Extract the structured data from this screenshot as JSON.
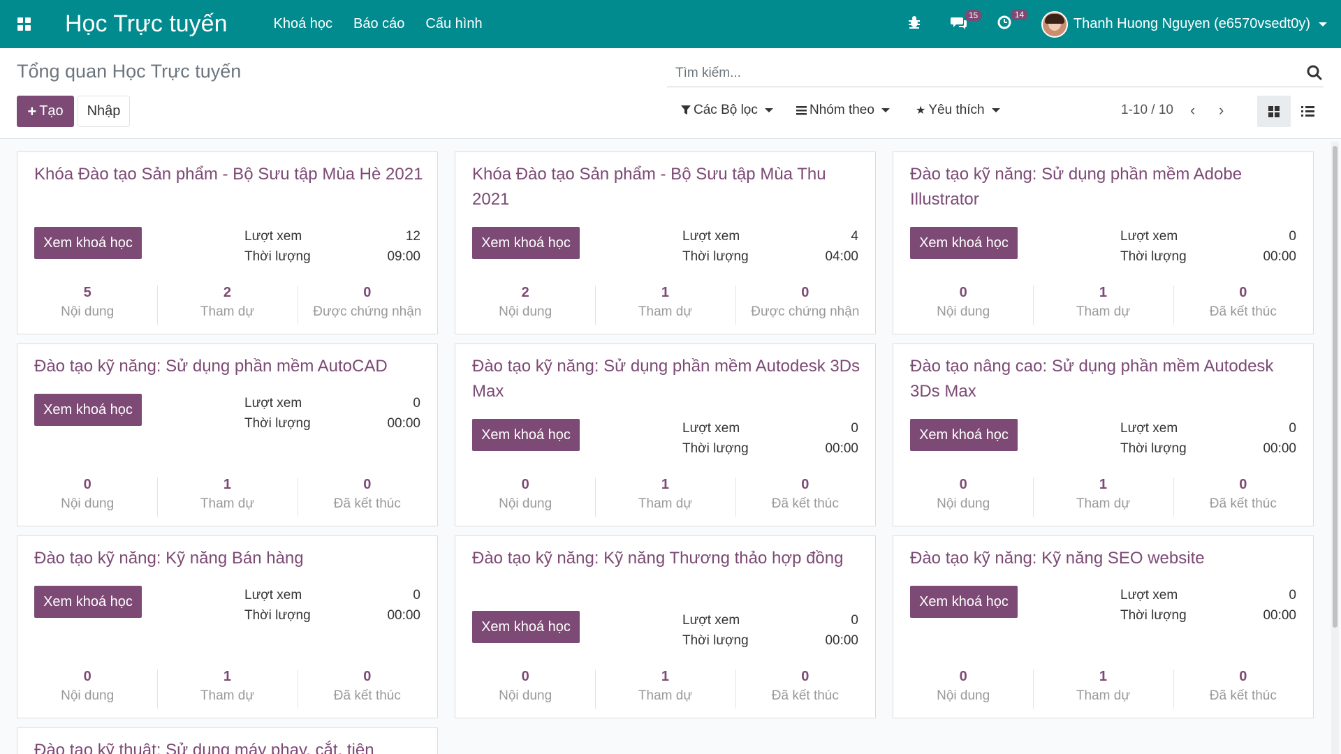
{
  "navbar": {
    "brand": "Học Trực tuyến",
    "menu": [
      "Khoá học",
      "Báo cáo",
      "Cấu hình"
    ],
    "messages_count": "15",
    "activities_count": "14",
    "user_name": "Thanh Huong Nguyen (e6570vsedt0y)"
  },
  "control": {
    "title": "Tổng quan Học Trực tuyến",
    "create_label": "Tạo",
    "import_label": "Nhập",
    "search_placeholder": "Tìm kiếm...",
    "filters_label": "Các Bộ lọc",
    "groupby_label": "Nhóm theo",
    "favorites_label": "Yêu thích",
    "pager": "1-10 / 10"
  },
  "card_labels": {
    "view_button": "Xem khoá học",
    "views": "Lượt xem",
    "duration": "Thời lượng",
    "content": "Nội dung",
    "attendees": "Tham dự",
    "certified": "Được chứng nhận",
    "finished": "Đã kết thúc"
  },
  "courses": [
    {
      "title": "Khóa Đào tạo Sản phẩm - Bộ Sưu tập Mùa Hè 2021",
      "views": "12",
      "duration": "09:00",
      "content": "5",
      "attendees": "2",
      "third_value": "0",
      "third_label": "Được chứng nhận"
    },
    {
      "title": "Khóa Đào tạo Sản phẩm - Bộ Sưu tập Mùa Thu 2021",
      "views": "4",
      "duration": "04:00",
      "content": "2",
      "attendees": "1",
      "third_value": "0",
      "third_label": "Được chứng nhận"
    },
    {
      "title": "Đào tạo kỹ năng: Sử dụng phần mềm Adobe Illustrator",
      "views": "0",
      "duration": "00:00",
      "content": "0",
      "attendees": "1",
      "third_value": "0",
      "third_label": "Đã kết thúc"
    },
    {
      "title": "Đào tạo kỹ năng: Sử dụng phần mềm AutoCAD",
      "views": "0",
      "duration": "00:00",
      "content": "0",
      "attendees": "1",
      "third_value": "0",
      "third_label": "Đã kết thúc"
    },
    {
      "title": "Đào tạo kỹ năng: Sử dụng phần mềm Autodesk 3Ds Max",
      "views": "0",
      "duration": "00:00",
      "content": "0",
      "attendees": "1",
      "third_value": "0",
      "third_label": "Đã kết thúc"
    },
    {
      "title": "Đào tạo nâng cao: Sử dụng phần mềm Autodesk 3Ds Max",
      "views": "0",
      "duration": "00:00",
      "content": "0",
      "attendees": "1",
      "third_value": "0",
      "third_label": "Đã kết thúc"
    },
    {
      "title": "Đào tạo kỹ năng: Kỹ năng Bán hàng",
      "views": "0",
      "duration": "00:00",
      "content": "0",
      "attendees": "1",
      "third_value": "0",
      "third_label": "Đã kết thúc"
    },
    {
      "title": "Đào tạo kỹ năng: Kỹ năng Thương thảo hợp đồng",
      "views": "0",
      "duration": "00:00",
      "content": "0",
      "attendees": "1",
      "third_value": "0",
      "third_label": "Đã kết thúc"
    },
    {
      "title": "Đào tạo kỹ năng: Kỹ năng SEO website",
      "views": "0",
      "duration": "00:00",
      "content": "0",
      "attendees": "1",
      "third_value": "0",
      "third_label": "Đã kết thúc"
    },
    {
      "title": "Đào tạo kỹ thuật: Sử dụng máy phay, cắt, tiện",
      "views": "",
      "duration": "",
      "content": "",
      "attendees": "",
      "third_value": "",
      "third_label": ""
    }
  ]
}
